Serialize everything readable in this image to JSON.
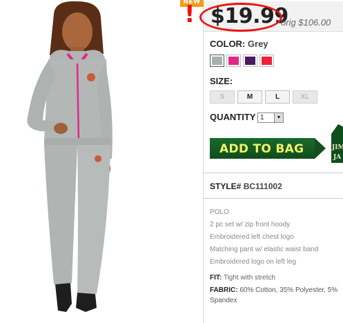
{
  "badge": {
    "new_label": "NEW",
    "exclaim": "!"
  },
  "price": {
    "current": "$19.99",
    "original": "orig $106.00"
  },
  "color": {
    "label": "COLOR:",
    "value": "Grey",
    "swatches": [
      {
        "name": "Grey",
        "hex": "#a9b0ad",
        "selected": true
      },
      {
        "name": "Pink",
        "hex": "#e4268a"
      },
      {
        "name": "Purple",
        "hex": "#4a1a62"
      },
      {
        "name": "Red",
        "hex": "#f0203d"
      }
    ]
  },
  "size": {
    "label": "SIZE:",
    "options": [
      "S",
      "M",
      "L",
      "XL"
    ]
  },
  "quantity": {
    "label": "QUANTITY",
    "value": "1"
  },
  "add_to_bag": {
    "label": "ADD TO BAG"
  },
  "brand_tag": {
    "line1": "JIM",
    "line2": "JA"
  },
  "style": {
    "label": "STYLE#",
    "code": "BC111002"
  },
  "description": [
    "POLO",
    "2 pc set w/ zip front hoody",
    "Embroidered left chest logo",
    "Matching pant w/ elastic waist band",
    "Embroidered logo on left leg"
  ],
  "fit": {
    "label": "FIT:",
    "value": "Tight with stretch"
  },
  "fabric": {
    "label": "FABRIC:",
    "value": "60% Cotton, 35% Polyester, 5% Spandex"
  },
  "colors": {
    "accent_green": "#0f4d1c",
    "accent_yellow": "#f0f26a",
    "alert_red": "#e11111",
    "new_orange": "#f39a1c"
  }
}
